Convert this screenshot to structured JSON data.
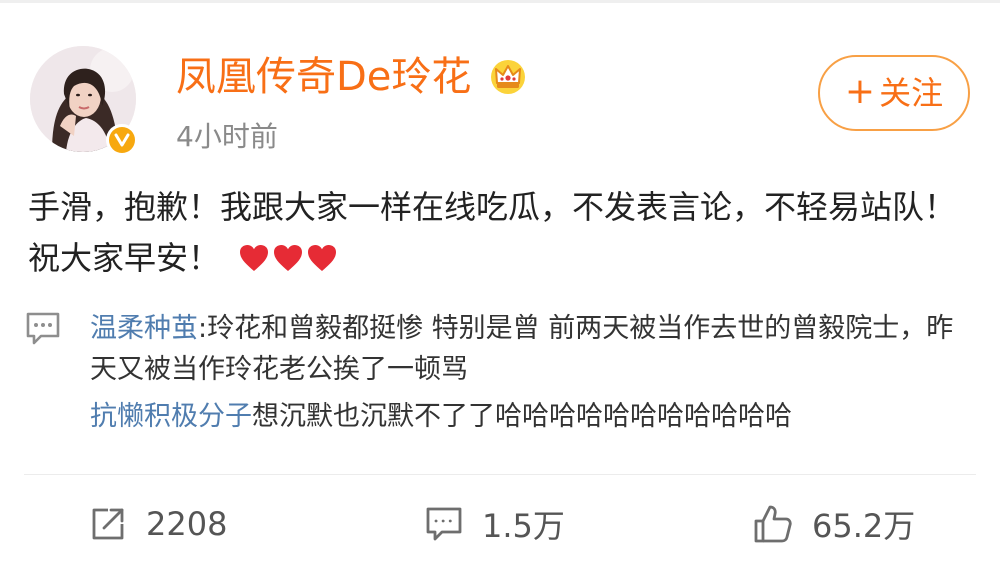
{
  "post": {
    "username": "凤凰传奇De玲花",
    "timestamp": "4小时前",
    "follow_label": "关注",
    "follow_plus": "+",
    "text": "手滑，抱歉！我跟大家一样在线吃瓜，不发表言论，不轻易站队！祝大家早安！",
    "emoji_count": 3
  },
  "comments": [
    {
      "user": "温柔种茧",
      "text": ":玲花和曾毅都挺惨 特别是曾 前两天被当作去世的曾毅院士，昨天又被当作玲花老公挨了一顿骂"
    },
    {
      "user": "抗懒积极分子",
      "text": "想沉默也沉默不了了哈哈哈哈哈哈哈哈哈哈哈"
    }
  ],
  "actions": {
    "reposts": "2208",
    "comments": "1.5万",
    "likes": "65.2万"
  },
  "icons": {
    "verified": "verified-badge-icon",
    "vip": "crown-icon",
    "heart": "heart-icon",
    "comment": "comment-icon",
    "repost": "repost-icon",
    "like": "thumbs-up-icon"
  },
  "colors": {
    "username": "#f86f16",
    "follow_border": "#f8a045",
    "link": "#507daf",
    "verified": "#f7a80f",
    "heart": "#e62b35"
  }
}
